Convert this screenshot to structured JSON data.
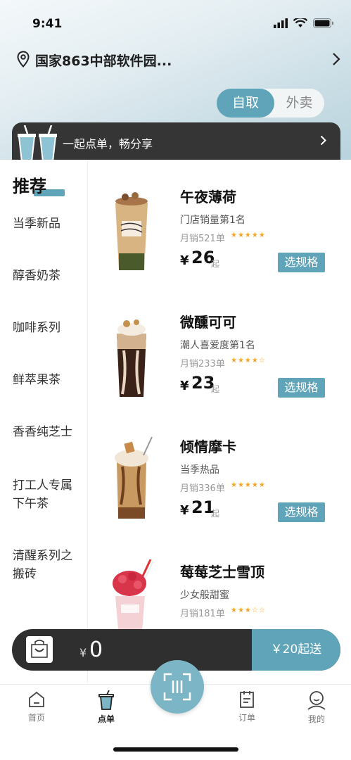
{
  "status": {
    "time": "9:41"
  },
  "location": {
    "address": "国家863中部软件园..."
  },
  "mode_toggle": {
    "active": "自取",
    "inactive": "外卖"
  },
  "group_banner": {
    "text": "一起点单，畅分享"
  },
  "sidebar": {
    "title": "推荐",
    "items": [
      {
        "label": "当季新品"
      },
      {
        "label": "醇香奶茶"
      },
      {
        "label": "咖啡系列"
      },
      {
        "label": "鲜萃果茶"
      },
      {
        "label": "香香纯芝士"
      },
      {
        "label": "打工人专属下午茶"
      },
      {
        "label": "清醒系列之搬砖"
      }
    ]
  },
  "products": [
    {
      "name": "午夜薄荷",
      "tag": "门店销量第1名",
      "sales": "月销521单",
      "rating": 5,
      "stars": "★★★★★",
      "currency": "¥",
      "price": "26",
      "price_suffix": "起",
      "button": "选规格"
    },
    {
      "name": "微醺可可",
      "tag": "潮人喜爱度第1名",
      "sales": "月销233单",
      "rating": 4.5,
      "stars": "★★★★☆",
      "currency": "¥",
      "price": "23",
      "price_suffix": "起",
      "button": "选规格"
    },
    {
      "name": "倾情摩卡",
      "tag": "当季热品",
      "sales": "月销336单",
      "rating": 5,
      "stars": "★★★★★",
      "currency": "¥",
      "price": "21",
      "price_suffix": "起",
      "button": "选规格"
    },
    {
      "name": "莓莓芝士雪顶",
      "tag": "少女般甜蜜",
      "sales": "月销181单",
      "rating": 3.5,
      "stars": "★★★☆☆"
    }
  ],
  "cart": {
    "currency": "¥",
    "amount": "0",
    "checkout": "￥20起送"
  },
  "tabs": [
    {
      "label": "首页",
      "icon": "home-icon"
    },
    {
      "label": "点单",
      "icon": "cup-icon",
      "active": true
    },
    {
      "label": "订单",
      "icon": "order-icon"
    },
    {
      "label": "我的",
      "icon": "profile-icon"
    }
  ],
  "colors": {
    "accent": "#5fa4b8",
    "dark": "#2f2f2f",
    "star": "#f5a623"
  }
}
